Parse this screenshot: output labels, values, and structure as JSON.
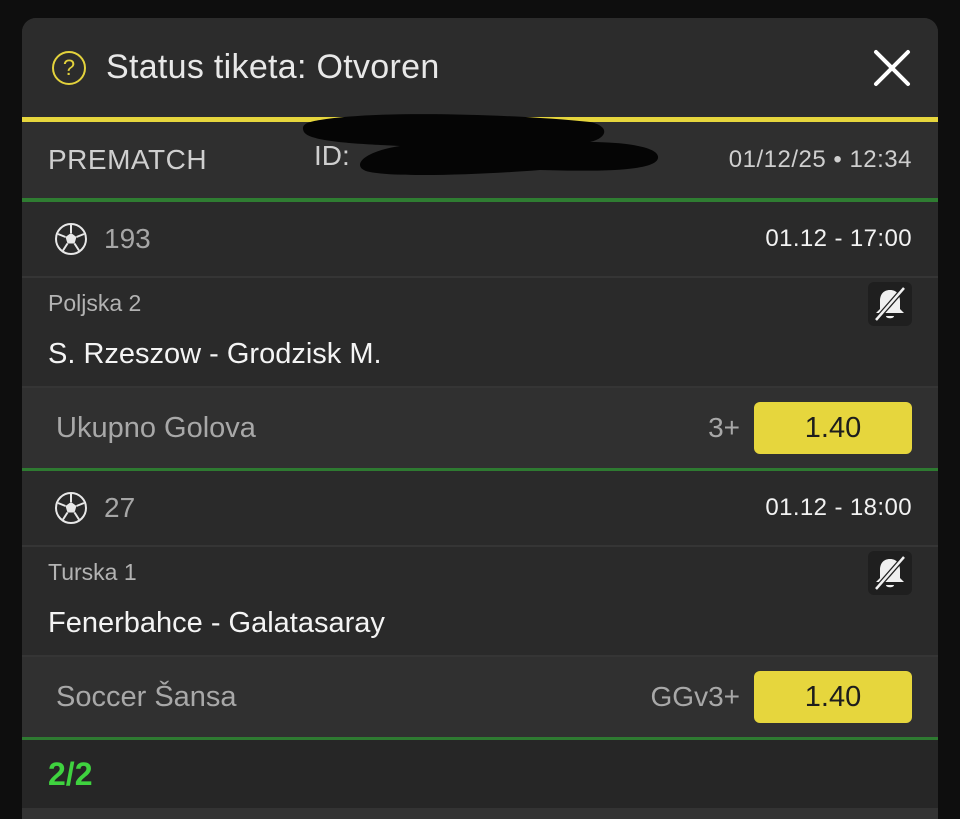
{
  "header": {
    "help_icon": "?",
    "title": "Status tiketa: Otvoren"
  },
  "ticket": {
    "type": "PREMATCH",
    "id_label": "ID:",
    "date": "01/12/25 • 12:34"
  },
  "events": [
    {
      "code": "193",
      "time": "01.12  -  17:00",
      "league": "Poljska 2",
      "match": "S. Rzeszow - Grodzisk M.",
      "market": "Ukupno Golova",
      "pick": "3+",
      "odd": "1.40"
    },
    {
      "code": "27",
      "time": "01.12  -  18:00",
      "league": "Turska 1",
      "match": "Fenerbahce - Galatasaray",
      "market": "Soccer Šansa",
      "pick": "GGv3+",
      "odd": "1.40"
    }
  ],
  "footer": {
    "count": "2/2"
  },
  "colors": {
    "accent_yellow": "#e6d63d",
    "accent_green": "#3fd33f",
    "divider_green": "#2f7d32"
  },
  "icons": [
    "help-icon",
    "close-icon",
    "soccer-ball-icon",
    "bell-off-icon"
  ]
}
